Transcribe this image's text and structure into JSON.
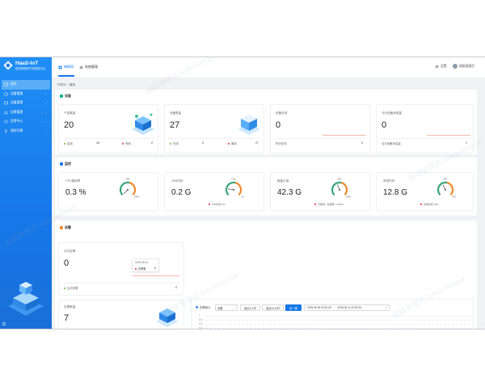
{
  "app": {
    "name": "HaaS-IoT",
    "subtitle": "智慧物联网开放数据平台"
  },
  "sidebar": {
    "items": [
      {
        "label": "首页",
        "icon": "home-icon",
        "active": true
      },
      {
        "label": "设备管理",
        "icon": "device-icon",
        "expandable": true
      },
      {
        "label": "设备管理",
        "icon": "device-manage-icon",
        "expandable": true
      },
      {
        "label": "告警管理",
        "icon": "alarm-icon",
        "expandable": true
      },
      {
        "label": "告警中心",
        "icon": "alert-center-icon",
        "expandable": true
      },
      {
        "label": "规则引擎",
        "icon": "rule-icon",
        "expandable": true
      }
    ]
  },
  "header": {
    "tabs": [
      {
        "label": "物联网",
        "icon": "iot-icon",
        "active": true
      },
      {
        "label": "系统管理",
        "icon": "system-icon",
        "active": false
      }
    ],
    "settings_label": "设置",
    "user_name": "超级管理员"
  },
  "breadcrumb": {
    "parent": "物联网",
    "current": "首页"
  },
  "sections": {
    "devices": "设备",
    "monitor": "监控",
    "alarms": "告警"
  },
  "device_cards": [
    {
      "label": "产品数量",
      "value": "20",
      "foot": [
        {
          "label": "启用",
          "value": "18",
          "color": "#52c41a"
        },
        {
          "label": "停用",
          "value": "2",
          "color": "#f5222d"
        }
      ]
    },
    {
      "label": "设备数量",
      "value": "27",
      "foot": [
        {
          "label": "在线",
          "value": "0",
          "color": "#52c41a"
        },
        {
          "label": "离线",
          "value": "27",
          "color": "#f5222d"
        }
      ]
    },
    {
      "label": "设备在线",
      "value": "0",
      "foot": [
        {
          "label": "昨日在线",
          "value": "0",
          "color": ""
        }
      ]
    },
    {
      "label": "今日设备消息量",
      "value": "0",
      "foot": [
        {
          "label": "当月设备消息量",
          "value": "1",
          "color": ""
        }
      ]
    }
  ],
  "monitor_cards": [
    {
      "label": "CPU使用率",
      "value": "0.3 %",
      "gauge_max": "100%",
      "gauge_top": "50%",
      "gauge_fill": 0.003,
      "sub": ""
    },
    {
      "label": "JVM内存",
      "value": "0.2 G",
      "gauge_max": "1G",
      "gauge_top": "0.5G",
      "gauge_fill": 0.2,
      "sub": "JVM内存 1G"
    },
    {
      "label": "磁盘占用",
      "value": "42.3 G",
      "gauge_max": "100G",
      "gauge_top": "50G",
      "gauge_fill": 0.42,
      "sub": "已使用 / 总容量 / (1303)"
    },
    {
      "label": "系统内存",
      "value": "12.8 G",
      "gauge_max": "32G",
      "gauge_top": "16G",
      "gauge_fill": 0.4,
      "sub": "系统内存 32G"
    }
  ],
  "alarm_cards": [
    {
      "label": "今日告警",
      "value": "0",
      "foot_label": "当月告警",
      "foot_value": "0"
    },
    {
      "label": "告警数量",
      "value": "7"
    }
  ],
  "tooltip": {
    "date": "2025-06-01",
    "label": "告警数",
    "value": "0"
  },
  "chart": {
    "legend": "告警统计",
    "select_value": "设备",
    "buttons": [
      "最近1小时",
      "最近24小时",
      "近一周"
    ],
    "active_button": "近一周",
    "range_start": "2025-06-05 20:02:26",
    "range_end": "2025-06-11 20:02:26",
    "range_sep": "~",
    "yticks": [
      "1",
      "0.8",
      "0.6",
      "0.4",
      "0.2"
    ]
  },
  "chart_data": {
    "type": "line",
    "series": [
      {
        "name": "告警统计",
        "values": []
      }
    ],
    "ylim": [
      0,
      1
    ]
  },
  "watermark": "超级管理员 Administrator",
  "colors": {
    "primary": "#1677e8",
    "success": "#52c41a",
    "danger": "#f5222d",
    "gauge_green": "#3aa57a",
    "gauge_orange": "#f08a2c"
  }
}
